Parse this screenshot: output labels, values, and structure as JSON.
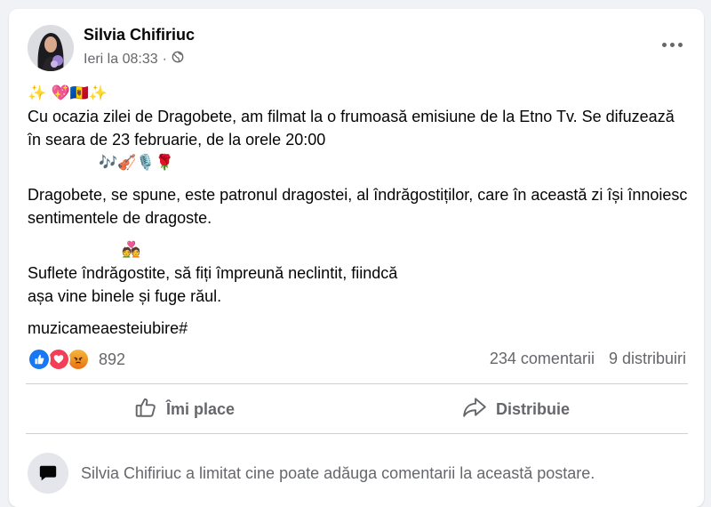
{
  "post": {
    "author": "Silvia Chifiriuc",
    "time": "Ieri la 08:33",
    "separator": "·",
    "line1_emojis": "✨ 💖🇲🇩✨",
    "para1": "Cu ocazia zilei de Dragobete, am filmat la o frumoasă emisiune de la Etno Tv. Se difuzează în seara de 23 februarie, de la orele 20:00",
    "line2_emojis": "🎶🎻🎙️🌹",
    "para2": "Dragobete, se spune, este patronul dragostei, al îndrăgostiților, care în această zi își înnoiesc sentimentele de dragoste.",
    "line3_emojis": "💑",
    "para3_line1": "Suflete îndrăgostite, să fiți împreună neclintit, fiindcă",
    "para3_line2": "așa vine binele și fuge răul.",
    "hashtag": "muzicameaesteiubire#"
  },
  "reactions": {
    "types": [
      "like-icon",
      "love-icon",
      "angry-icon"
    ],
    "count": "892",
    "comments": "234 comentarii",
    "shares": "9 distribuiri"
  },
  "actions": {
    "like_label": "Îmi place",
    "share_label": "Distribuie"
  },
  "notice": {
    "text": "Silvia Chifiriuc a limitat cine poate adăuga comentarii la această postare."
  },
  "colors": {
    "like": "#1877f2",
    "love": "#f33e58",
    "angry": "#e9710f",
    "secondary_text": "#65676b"
  }
}
